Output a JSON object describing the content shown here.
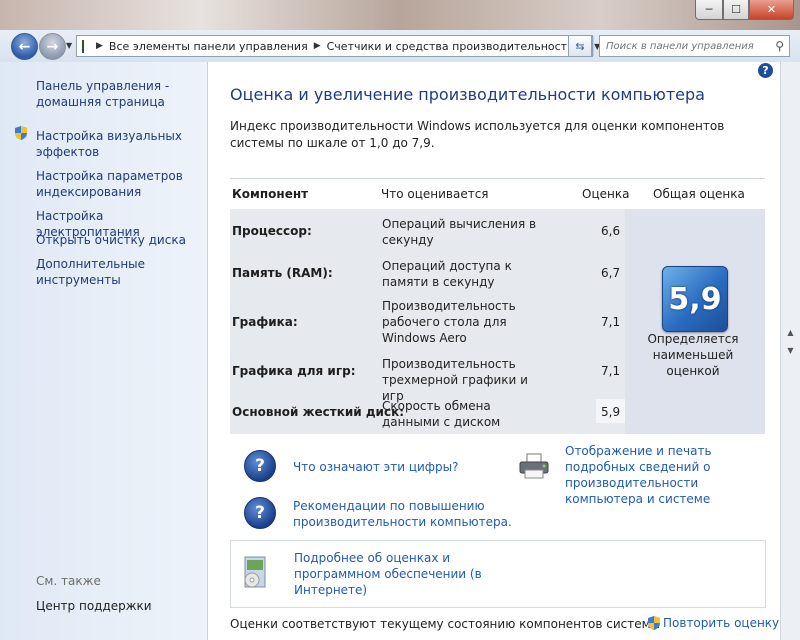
{
  "window": {
    "minimize_glyph": "─",
    "maximize_glyph": "☐",
    "close_glyph": "✕"
  },
  "navigation": {
    "back_glyph": "←",
    "forward_glyph": "→",
    "breadcrumb": [
      "Все элементы панели управления",
      "Счетчики и средства производительности"
    ],
    "search_placeholder": "Поиск в панели управления"
  },
  "sidebar": {
    "items": [
      {
        "label": "Панель управления - домашняя страница"
      },
      {
        "label": "Настройка визуальных эффектов",
        "icon": "uac-shield-icon"
      },
      {
        "label": "Настройка параметров индексирования"
      },
      {
        "label": "Настройка электропитания"
      },
      {
        "label": "Открыть очистку диска"
      },
      {
        "label": "Дополнительные инструменты"
      }
    ],
    "see_also_label": "См. также",
    "see_also_items": [
      {
        "label": "Центр поддержки"
      }
    ]
  },
  "main": {
    "help_glyph": "?",
    "title": "Оценка и увеличение производительности компьютера",
    "intro": "Индекс производительности Windows используется для оценки компонентов системы по шкале от 1,0 до 7,9.",
    "table": {
      "headers": {
        "component": "Компонент",
        "what": "Что оценивается",
        "score": "Оценка",
        "total": "Общая оценка"
      },
      "rows": [
        {
          "component": "Процессор:",
          "what": "Операций вычисления в секунду",
          "score": "6,6"
        },
        {
          "component": "Память (RAM):",
          "what": "Операций доступа к памяти в секунду",
          "score": "6,7"
        },
        {
          "component": "Графика:",
          "what": "Производительность рабочего стола для Windows Aero",
          "score": "7,1"
        },
        {
          "component": "Графика для игр:",
          "what": "Производительность трехмерной графики и игр",
          "score": "7,1"
        },
        {
          "component": "Основной жесткий диск:",
          "what": "Скорость обмена данными с диском",
          "score": "5,9"
        }
      ],
      "base_score": "5,9",
      "base_score_caption": "Определяется наименьшей оценкой"
    },
    "links": {
      "what_numbers_mean": "Что означают эти цифры?",
      "print_details": "Отображение и печать подробных сведений о производительности компьютера и системе",
      "tips": "Рекомендации по повышению производительности компьютера.",
      "more_info": "Подробнее об оценках и программном обеспечении (в Интернете)"
    },
    "footer_status": "Оценки соответствуют текущему состоянию компонентов системы",
    "rerun_label": "Повторить оценку"
  }
}
